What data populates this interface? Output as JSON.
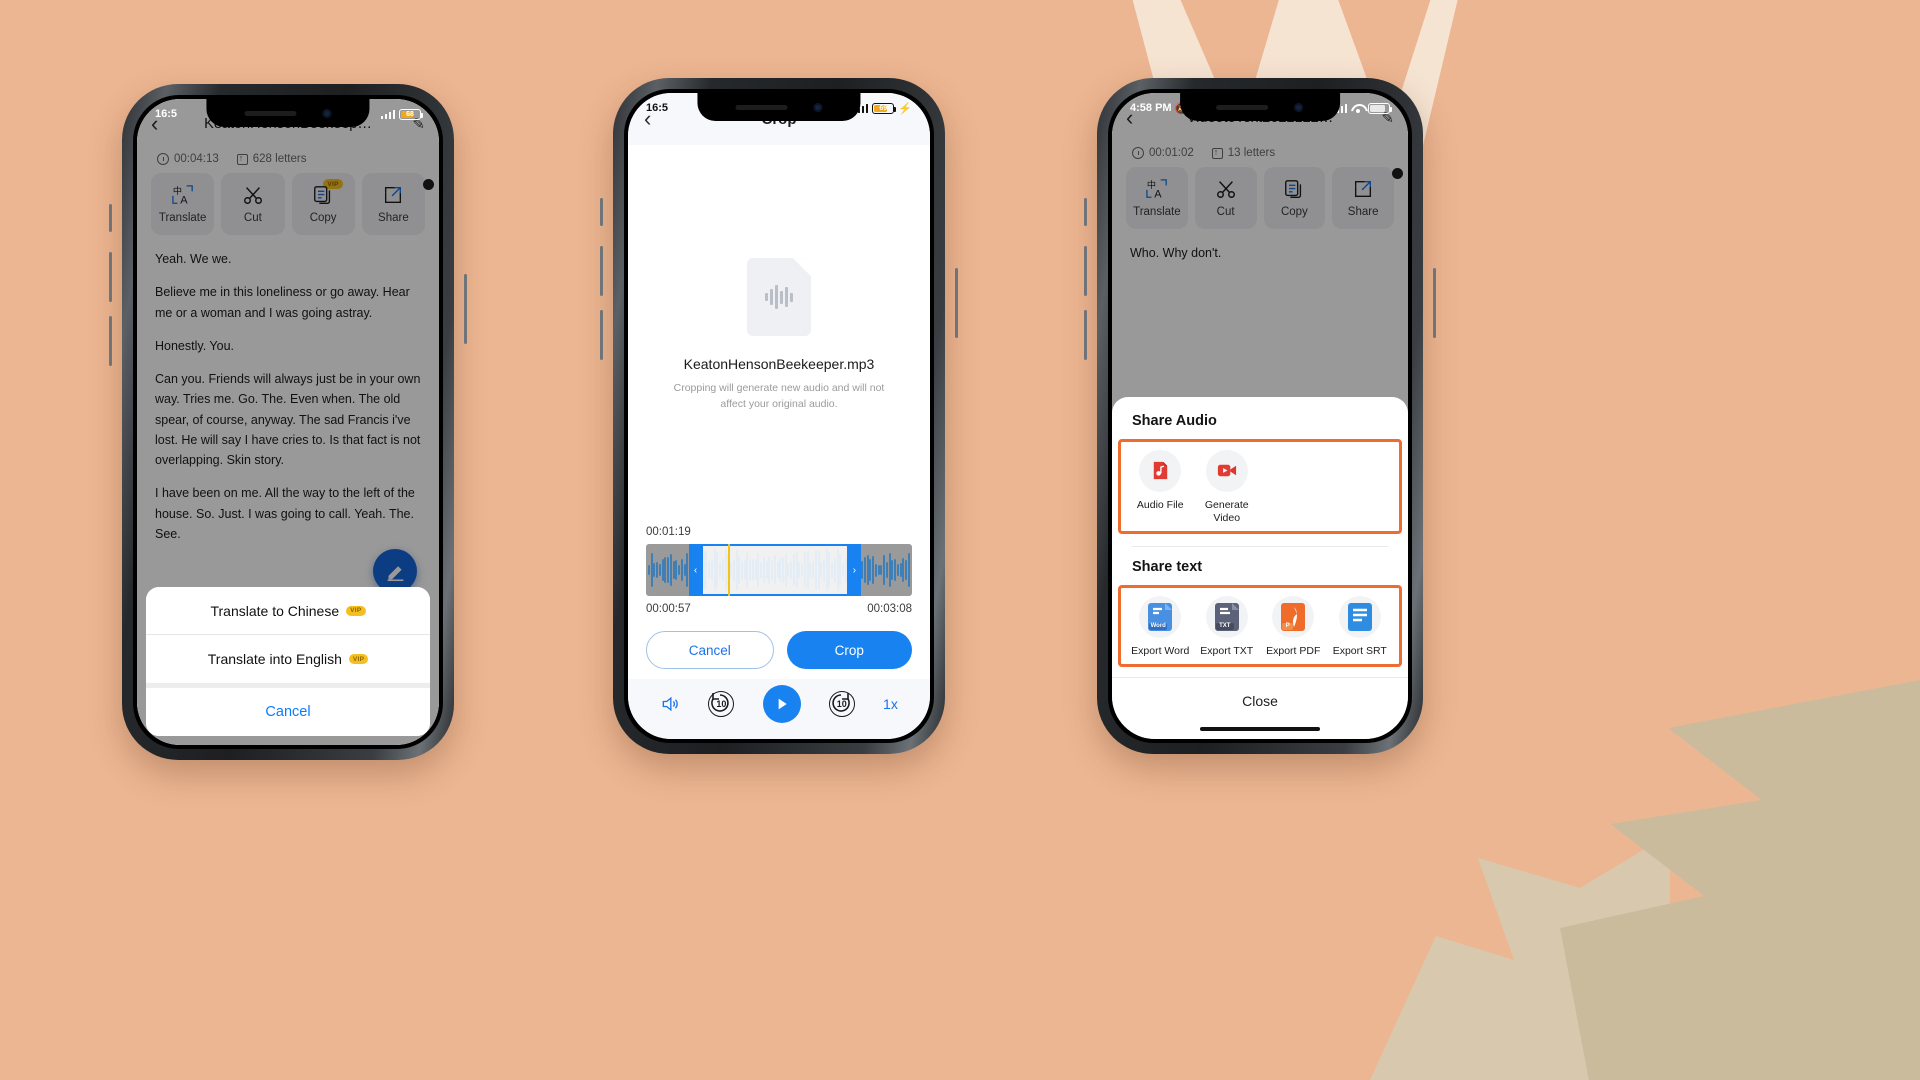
{
  "background": {
    "color": "#edb692"
  },
  "phone1": {
    "status": {
      "time": "16:5",
      "battery": "68"
    },
    "nav": {
      "back_icon": "chevron-left-icon",
      "title": "KeatonHensonBeekeep…",
      "edit_icon": "pencil-icon"
    },
    "meta": {
      "duration": "00:04:13",
      "letters": "628 letters"
    },
    "actions": [
      {
        "label": "Translate",
        "icon": "translate-icon",
        "vip": false
      },
      {
        "label": "Cut",
        "icon": "scissors-icon",
        "vip": false
      },
      {
        "label": "Copy",
        "icon": "copy-icon",
        "vip": true,
        "vip_label": "VIP"
      },
      {
        "label": "Share",
        "icon": "share-icon",
        "vip": false
      }
    ],
    "transcript": [
      "Yeah. We we.",
      "Believe me in this loneliness or go away. Hear me or a woman and I was going astray.",
      "Honestly. You.",
      "Can you. Friends will always just be in your own way. Tries me. Go. The. Even when. The old spear, of course, anyway. The sad Francis i've lost. He will say I have cries to. Is that fact is not overlapping. Skin story.",
      "I have been on me. All the way to the left of the house. So. Just. I was going to call. Yeah. The. See."
    ],
    "fab_icon": "edit-pencil-icon",
    "sheet": {
      "options": [
        {
          "label": "Translate to Chinese",
          "vip": true,
          "vip_label": "VIP"
        },
        {
          "label": "Translate into English",
          "vip": true,
          "vip_label": "VIP"
        }
      ],
      "cancel": "Cancel"
    }
  },
  "phone2": {
    "status": {
      "time": "16:5",
      "battery": "69"
    },
    "nav": {
      "back_icon": "chevron-left-icon",
      "title": "Crop"
    },
    "file": {
      "icon": "audio-file-icon",
      "name": "KeatonHensonBeekeeper.mp3",
      "note": "Cropping will generate new audio and will not affect your original audio."
    },
    "timeline": {
      "current_time": "00:01:19",
      "start_time": "00:00:57",
      "end_time": "00:03:08",
      "left_handle_icon": "chevron-left-icon",
      "right_handle_icon": "chevron-right-icon"
    },
    "buttons": {
      "cancel": "Cancel",
      "crop": "Crop"
    },
    "player": {
      "volume_icon": "speaker-icon",
      "rewind_label": "10",
      "play_icon": "play-icon",
      "forward_label": "10",
      "speed": "1x"
    }
  },
  "phone3": {
    "status": {
      "time": "4:58 PM",
      "battery": "85",
      "mute_icon": "bell-slash-icon",
      "wifi_icon": "wifi-icon"
    },
    "nav": {
      "back_icon": "chevron-left-icon",
      "title": "VideotoText2022122…",
      "edit_icon": "pencil-icon"
    },
    "meta": {
      "duration": "00:01:02",
      "letters": "13 letters"
    },
    "actions": [
      {
        "label": "Translate",
        "icon": "translate-icon",
        "vip": false
      },
      {
        "label": "Cut",
        "icon": "scissors-icon",
        "vip": false
      },
      {
        "label": "Copy",
        "icon": "copy-icon",
        "vip": false
      },
      {
        "label": "Share",
        "icon": "share-icon",
        "vip": false
      }
    ],
    "transcript": [
      "Who. Why don't."
    ],
    "share_sheet": {
      "audio_title": "Share Audio",
      "audio_items": [
        {
          "label": "Audio File",
          "icon": "audio-file-red-icon"
        },
        {
          "label": "Generate Video",
          "icon": "video-camera-red-icon"
        }
      ],
      "text_title": "Share text",
      "text_items": [
        {
          "label": "Export Word",
          "icon": "word-doc-icon",
          "tag": "Word"
        },
        {
          "label": "Export TXT",
          "icon": "txt-doc-icon",
          "tag": "TXT"
        },
        {
          "label": "Export PDF",
          "icon": "pdf-doc-icon",
          "tag": "P"
        },
        {
          "label": "Export SRT",
          "icon": "srt-doc-icon",
          "tag": ""
        }
      ],
      "close": "Close",
      "highlight_color": "#ef6c30"
    }
  }
}
